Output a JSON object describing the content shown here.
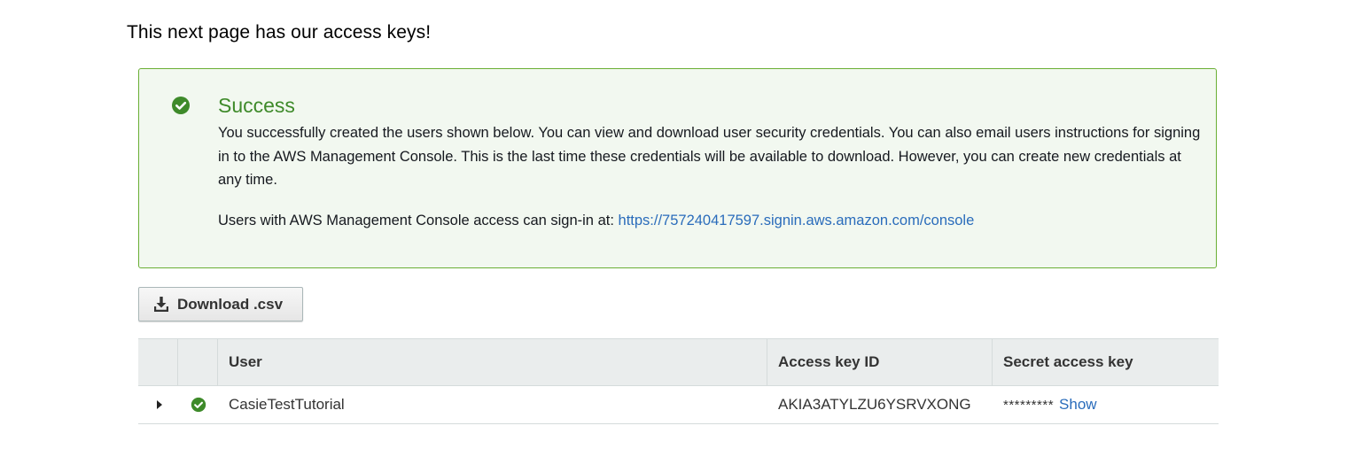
{
  "intro_text": "This next page has our access keys!",
  "alert": {
    "icon": "check-circle-icon",
    "title": "Success",
    "message": "You successfully created the users shown below. You can view and download user security credentials. You can also email users instructions for signing in to the AWS Management Console. This is the last time these credentials will be available to download. However, you can create new credentials at any time.",
    "signin_prefix": "Users with AWS Management Console access can sign-in at: ",
    "signin_link": "https://757240417597.signin.aws.amazon.com/console"
  },
  "download_button": {
    "label": "Download .csv",
    "icon": "download-icon"
  },
  "table": {
    "headers": [
      "",
      "",
      "User",
      "Access key ID",
      "Secret access key"
    ],
    "rows": [
      {
        "user": "CasieTestTutorial",
        "access_key_id": "AKIA3ATYLZU6YSRVXONG",
        "secret_masked": "*********",
        "secret_show_label": "Show",
        "status_icon": "check-circle-icon",
        "expand_icon": "caret-right-icon"
      }
    ]
  },
  "colors": {
    "success_green": "#3e8a2a",
    "alert_bg": "#f2f8f0",
    "alert_border": "#6aaf35",
    "link_blue": "#2a6cbb",
    "table_header_bg": "#eaeded"
  }
}
